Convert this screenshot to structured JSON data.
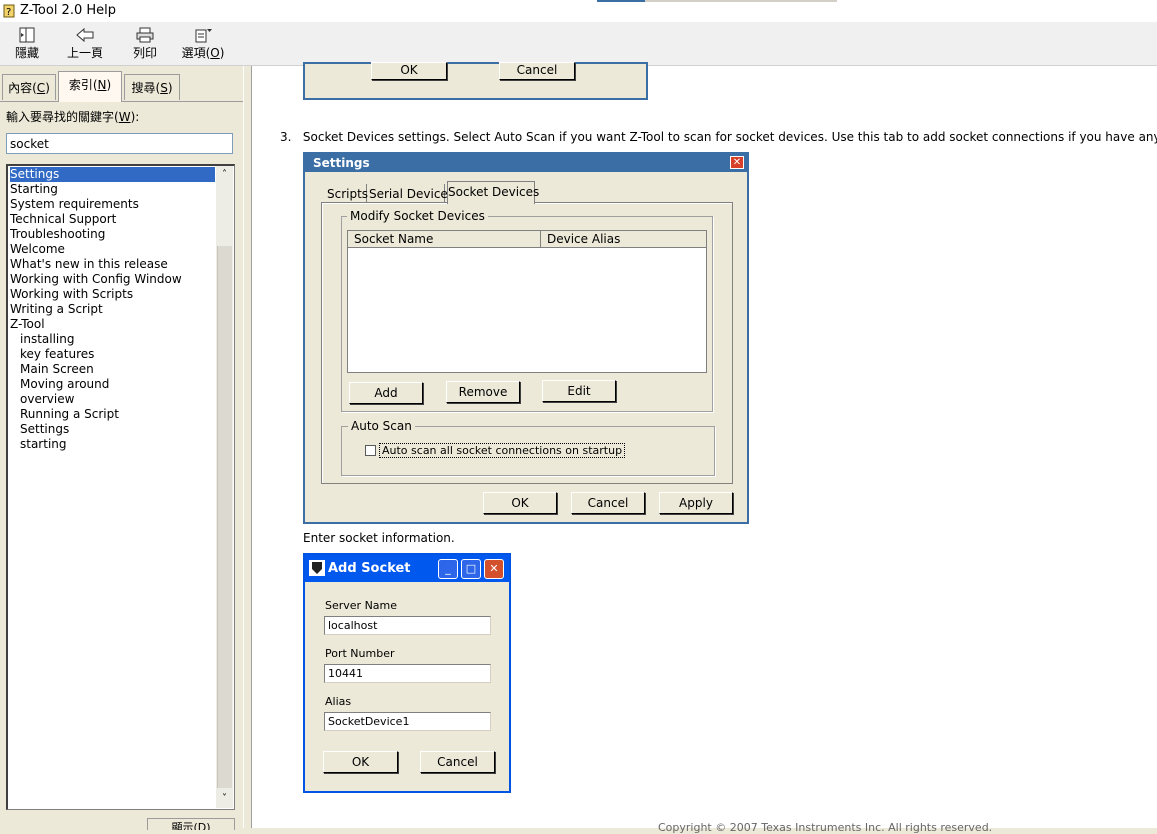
{
  "window": {
    "title": "Z-Tool 2.0 Help"
  },
  "toolbar": {
    "hide": {
      "label": "隱藏"
    },
    "back": {
      "label": "上一頁"
    },
    "print": {
      "label": "列印"
    },
    "options": {
      "label": "選項(",
      "accel": "O",
      "suffix": ")"
    }
  },
  "nav": {
    "tabs": [
      {
        "label": "內容(",
        "accel": "C",
        "suffix": ")"
      },
      {
        "label": "索引(",
        "accel": "N",
        "suffix": ")"
      },
      {
        "label": "搜尋(",
        "accel": "S",
        "suffix": ")"
      }
    ],
    "keyword_label": "輸入要尋找的關鍵字(",
    "keyword_accel": "W",
    "keyword_suffix": "):",
    "keyword_value": "socket",
    "items": [
      "Settings",
      "Starting",
      "System requirements",
      "Technical Support",
      "Troubleshooting",
      "Welcome",
      "What's new in this release",
      "Working with Config Window",
      "Working with Scripts",
      "Writing a Script",
      "Z-Tool"
    ],
    "subitems": [
      "installing",
      "key features",
      "Main Screen",
      "Moving around",
      "overview",
      "Running a Script",
      "Settings",
      "starting"
    ],
    "display_button": "顯示(D)"
  },
  "content": {
    "prev_dialog": {
      "ok": "OK",
      "cancel": "Cancel"
    },
    "step_number": "3.",
    "step_text": "Socket Devices settings.  Select Auto Scan if you want Z-Tool to scan for socket devices.  Use this tab to add socket connections if you have any.",
    "settings": {
      "title": "Settings",
      "tabs": [
        "Scripts",
        "Serial Devices",
        "Socket Devices"
      ],
      "modify_group": "Modify Socket Devices",
      "columns": [
        "Socket Name",
        "Device Alias"
      ],
      "add": "Add",
      "remove": "Remove",
      "edit": "Edit",
      "autoscan_group": "Auto Scan",
      "autoscan_checkbox": "Auto scan all socket connections on startup",
      "ok": "OK",
      "cancel": "Cancel",
      "apply": "Apply"
    },
    "enter_text": "Enter socket information.",
    "add_socket": {
      "title": "Add Socket",
      "server_label": "Server Name",
      "server_value": "localhost",
      "port_label": "Port Number",
      "port_value": "10441",
      "alias_label": "Alias",
      "alias_value": "SocketDevice1",
      "ok": "OK",
      "cancel": "Cancel"
    },
    "copyright": "Copyright © 2007 Texas Instruments Inc. All rights reserved."
  }
}
